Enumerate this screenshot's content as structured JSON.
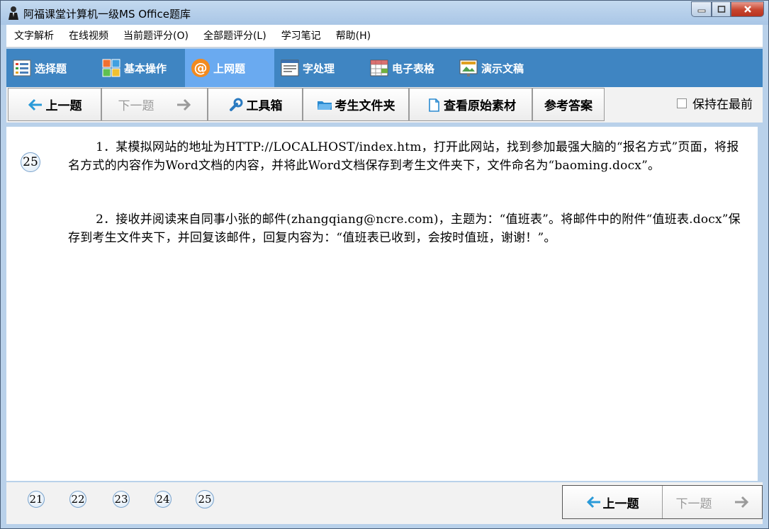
{
  "window": {
    "title": "阿福课堂计算机一级MS Office题库"
  },
  "menu": [
    "文字解析",
    "在线视频",
    "当前题评分(O)",
    "全部题评分(L)",
    "学习笔记",
    "帮助(H)"
  ],
  "modules": [
    {
      "label": "选择题",
      "icon": "list-icon"
    },
    {
      "label": "基本操作",
      "icon": "grid-icon"
    },
    {
      "label": "上网题",
      "icon": "at-icon"
    },
    {
      "label": "字处理",
      "icon": "document-icon"
    },
    {
      "label": "电子表格",
      "icon": "spreadsheet-icon"
    },
    {
      "label": "演示文稿",
      "icon": "slides-icon"
    }
  ],
  "active_module": "上网题",
  "actions": {
    "prev": "上一题",
    "next": "下一题",
    "toolbox": "工具箱",
    "folder": "考生文件夹",
    "source": "查看原始素材",
    "answer": "参考答案"
  },
  "keep_on_top": {
    "label": "保持在最前",
    "checked": false
  },
  "question": {
    "number": "25",
    "paragraphs": [
      "1．某模拟网站的地址为HTTP://LOCALHOST/index.htm，打开此网站，找到参加最强大脑的“报名方式”页面，将报名方式的内容作为Word文档的内容，并将此Word文档保存到考生文件夹下，文件命名为“baoming.docx”。",
      "2．接收并阅读来自同事小张的邮件(zhangqiang@ncre.com)，主题为：“值班表”。将邮件中的附件“值班表.docx”保存到考生文件夹下，并回复该邮件，回复内容为：“值班表已收到，会按时值班，谢谢！”。"
    ]
  },
  "pager": {
    "numbers": [
      "21",
      "22",
      "23",
      "24",
      "25"
    ],
    "prev": "上一题",
    "next": "下一题"
  },
  "colors": {
    "toolbar_blue": "#3f85c2",
    "active_tab": "#6aaaf0",
    "arrow_blue": "#2a9ad8"
  }
}
